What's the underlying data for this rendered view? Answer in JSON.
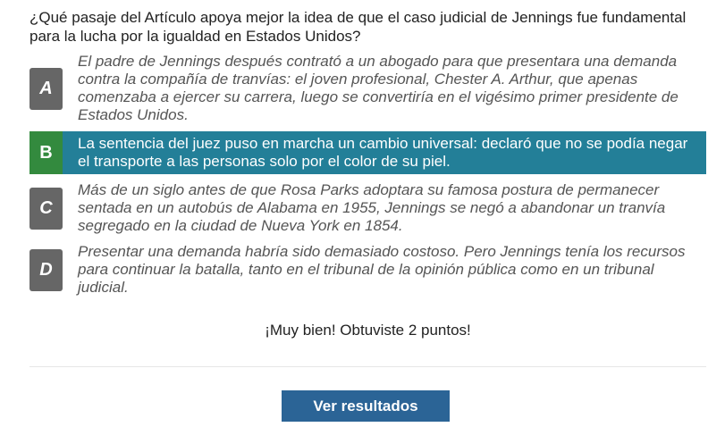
{
  "question": "¿Qué pasaje del Artículo apoya mejor la idea de que el caso judicial de Jennings fue fundamental para la lucha por la igualdad en Estados Unidos?",
  "options": [
    {
      "letter": "A",
      "text": "El padre de Jennings después contrató a un abogado para que presentara una demanda contra la compañía de tranvías: el joven profesional, Chester A. Arthur, que apenas comenzaba a ejercer su carrera, luego se convertiría en el vigésimo primer presidente de Estados Unidos.",
      "selected": false
    },
    {
      "letter": "B",
      "text": "La sentencia del juez puso en marcha un cambio universal: declaró que no se podía negar el transporte a las personas solo por el color de su piel.",
      "selected": true
    },
    {
      "letter": "C",
      "text": "Más de un siglo antes de que Rosa Parks adoptara su famosa postura de permanecer sentada en un autobús de Alabama en 1955, Jennings se negó a abandonar un tranvía segregado en la ciudad de Nueva York en 1854.",
      "selected": false
    },
    {
      "letter": "D",
      "text": "Presentar una demanda habría sido demasiado costoso. Pero Jennings tenía los recursos para continuar la batalla, tanto en el tribunal de la opinión pública como en un tribunal judicial.",
      "selected": false
    }
  ],
  "feedback": "¡Muy bien! Obtuviste 2 puntos!",
  "results_button": "Ver resultados",
  "colors": {
    "selected_bg": "#237f98",
    "correct_letter_bg": "#338a3e",
    "letter_bg": "#666666",
    "button_bg": "#2b6496"
  }
}
